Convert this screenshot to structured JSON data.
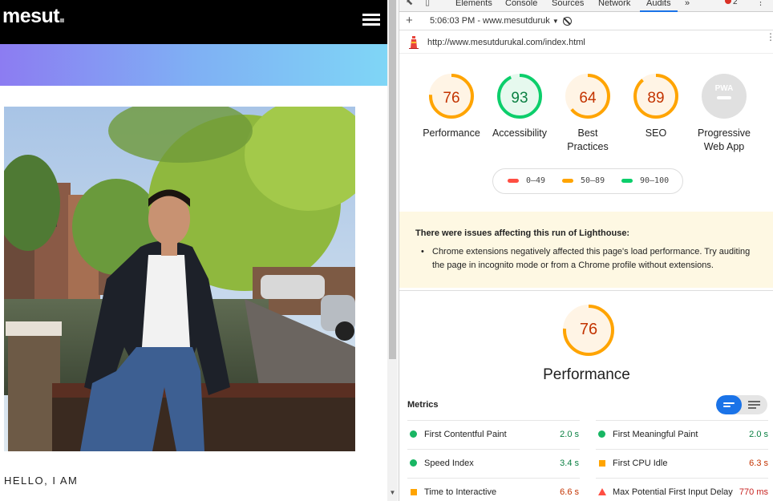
{
  "site": {
    "logo": "mesut",
    "hello_text": "HELLO, I AM"
  },
  "devtools": {
    "tabs": [
      {
        "label": "Elements"
      },
      {
        "label": "Console"
      },
      {
        "label": "Sources"
      },
      {
        "label": "Network"
      },
      {
        "label": "Audits",
        "active": true
      }
    ],
    "more_tabs": "»",
    "error_count": "2",
    "report_selector": "5:06:03 PM - www.mesutduruk",
    "url": "http://www.mesutdurukal.com/index.html"
  },
  "gauges": [
    {
      "label": "Performance",
      "score": "76",
      "value": 76,
      "status": "average"
    },
    {
      "label": "Accessibility",
      "score": "93",
      "value": 93,
      "status": "pass"
    },
    {
      "label": "Best Practices",
      "score": "64",
      "value": 64,
      "status": "average"
    },
    {
      "label": "SEO",
      "score": "89",
      "value": 89,
      "status": "average"
    },
    {
      "label": "Progressive Web App",
      "score": "PWA",
      "status": "na"
    }
  ],
  "legend": [
    {
      "range": "0–49",
      "color": "#ff4e42"
    },
    {
      "range": "50–89",
      "color": "#ffa400"
    },
    {
      "range": "90–100",
      "color": "#0cce6b"
    }
  ],
  "warning": {
    "title": "There were issues affecting this run of Lighthouse:",
    "item": "Chrome extensions negatively affected this page's load performance. Try auditing the page in incognito mode or from a Chrome profile without extensions."
  },
  "performance": {
    "score": "76",
    "value": 76,
    "title": "Performance"
  },
  "metrics": {
    "heading": "Metrics",
    "left": [
      {
        "label": "First Contentful Paint",
        "value": "2.0 s",
        "status": "good"
      },
      {
        "label": "Speed Index",
        "value": "3.4 s",
        "status": "good"
      },
      {
        "label": "Time to Interactive",
        "value": "6.6 s",
        "status": "avg"
      }
    ],
    "right": [
      {
        "label": "First Meaningful Paint",
        "value": "2.0 s",
        "status": "good"
      },
      {
        "label": "First CPU Idle",
        "value": "6.3 s",
        "status": "avg"
      },
      {
        "label": "Max Potential First Input Delay",
        "value": "770 ms",
        "status": "bad"
      }
    ]
  },
  "colors": {
    "pass": "#0cce6b",
    "average": "#ffa400",
    "fail": "#ff4e42",
    "accent": "#1a73e8"
  }
}
